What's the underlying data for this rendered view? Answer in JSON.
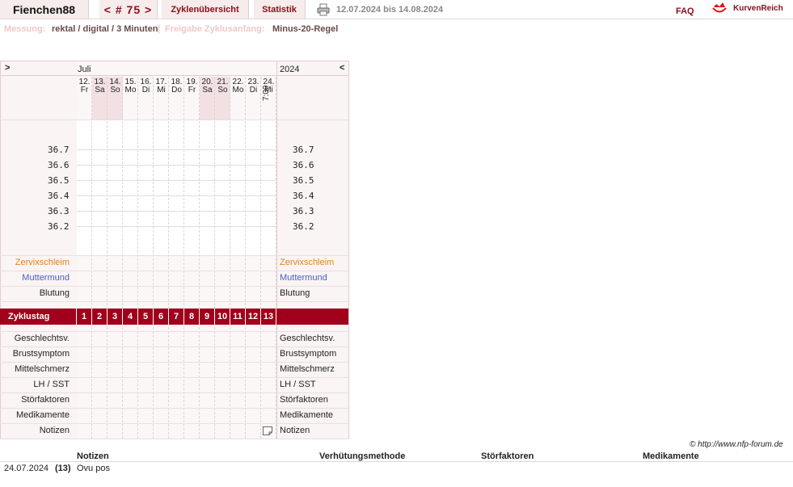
{
  "header": {
    "username": "Fienchen88",
    "cycle_nav": "< # 75 >",
    "tab_overview": "Zyklenübersicht",
    "tab_stats": "Statistik",
    "date_range": "12.07.2024 bis 14.08.2024",
    "faq": "FAQ",
    "brand": "KurvenReich"
  },
  "subheader": {
    "measure_label": "Messung:",
    "measure_value": "rektal / digital / 3 Minuten",
    "separator": "|",
    "release_label": "Freigabe Zyklusanfang:",
    "release_value": "Minus-20-Regel"
  },
  "chart": {
    "nav_left": ">",
    "month": "Juli",
    "year": "2024",
    "nav_right": "<",
    "days": [
      {
        "d": "12.",
        "w": "Fr",
        "weekend": false
      },
      {
        "d": "13.",
        "w": "Sa",
        "weekend": true
      },
      {
        "d": "14.",
        "w": "So",
        "weekend": true
      },
      {
        "d": "15.",
        "w": "Mo",
        "weekend": false
      },
      {
        "d": "16.",
        "w": "Di",
        "weekend": false
      },
      {
        "d": "17.",
        "w": "Mi",
        "weekend": false
      },
      {
        "d": "18.",
        "w": "Do",
        "weekend": false
      },
      {
        "d": "19.",
        "w": "Fr",
        "weekend": false
      },
      {
        "d": "20.",
        "w": "Sa",
        "weekend": true
      },
      {
        "d": "21.",
        "w": "So",
        "weekend": true
      },
      {
        "d": "22.",
        "w": "Mo",
        "weekend": false
      },
      {
        "d": "23.",
        "w": "Di",
        "weekend": false
      },
      {
        "d": "24.",
        "w": "Mi",
        "weekend": false
      }
    ],
    "time_last": "7:00",
    "temps": [
      "36.7",
      "36.6",
      "36.5",
      "36.4",
      "36.3",
      "36.2"
    ],
    "rows_top": [
      "Zervixschleim",
      "Muttermund",
      "Blutung"
    ],
    "zyklustag_label": "Zyklustag",
    "cycle_days": [
      "1",
      "2",
      "3",
      "4",
      "5",
      "6",
      "7",
      "8",
      "9",
      "10",
      "11",
      "12",
      "13"
    ],
    "rows_bottom": [
      "Geschlechtsv.",
      "Brustsymptom",
      "Mittelschmerz",
      "LH / SST",
      "Störfaktoren",
      "Medikamente",
      "Notizen"
    ],
    "colors": {
      "zervix": "#e8821e",
      "muttermund": "#4a5fc0",
      "accent": "#a0001c"
    }
  },
  "copyright": "© http://www.nfp-forum.de",
  "notes": {
    "headers": [
      "Notizen",
      "Verhütungsmethode",
      "Störfaktoren",
      "Medikamente"
    ],
    "rows": [
      {
        "date": "24.07.2024",
        "day": "(13)",
        "text": "Ovu pos"
      }
    ]
  }
}
